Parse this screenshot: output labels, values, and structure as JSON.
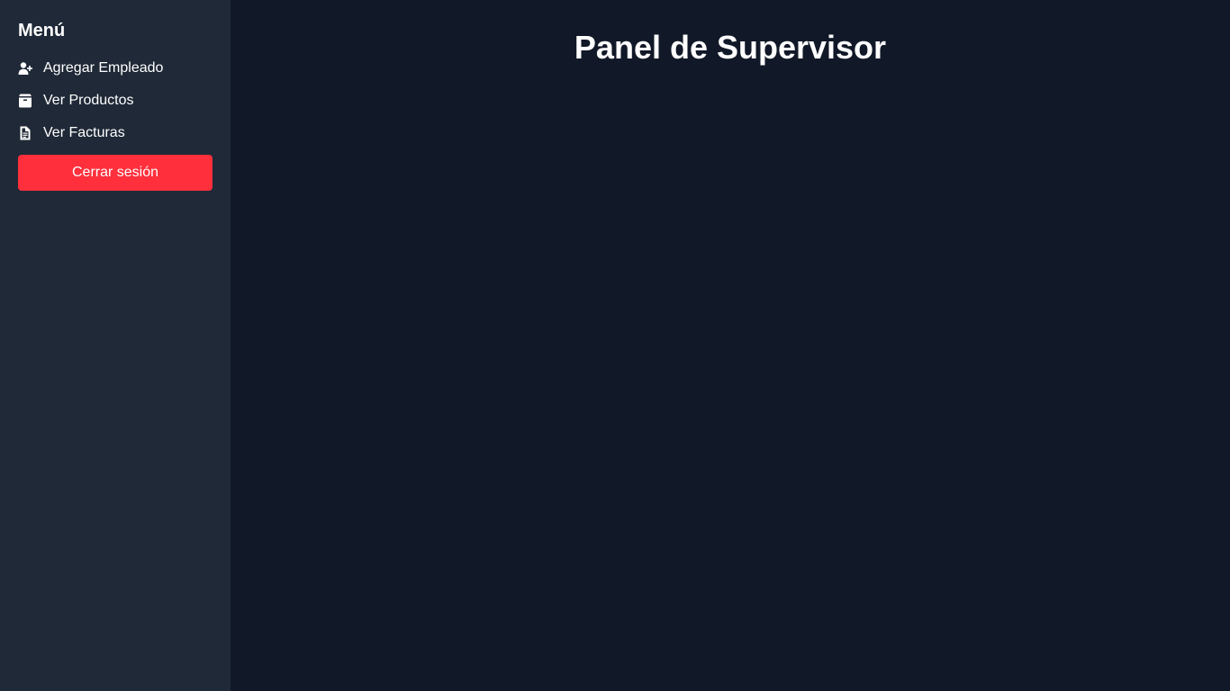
{
  "sidebar": {
    "title": "Menú",
    "items": [
      {
        "label": "Agregar Empleado",
        "icon": "user-plus-icon"
      },
      {
        "label": "Ver Productos",
        "icon": "box-icon"
      },
      {
        "label": "Ver Facturas",
        "icon": "file-invoice-icon"
      }
    ],
    "logout_label": "Cerrar sesión"
  },
  "main": {
    "title": "Panel de Supervisor"
  },
  "colors": {
    "sidebar_bg": "#1f2937",
    "main_bg": "#111827",
    "logout_bg": "#ff2f3c",
    "text": "#ffffff"
  }
}
